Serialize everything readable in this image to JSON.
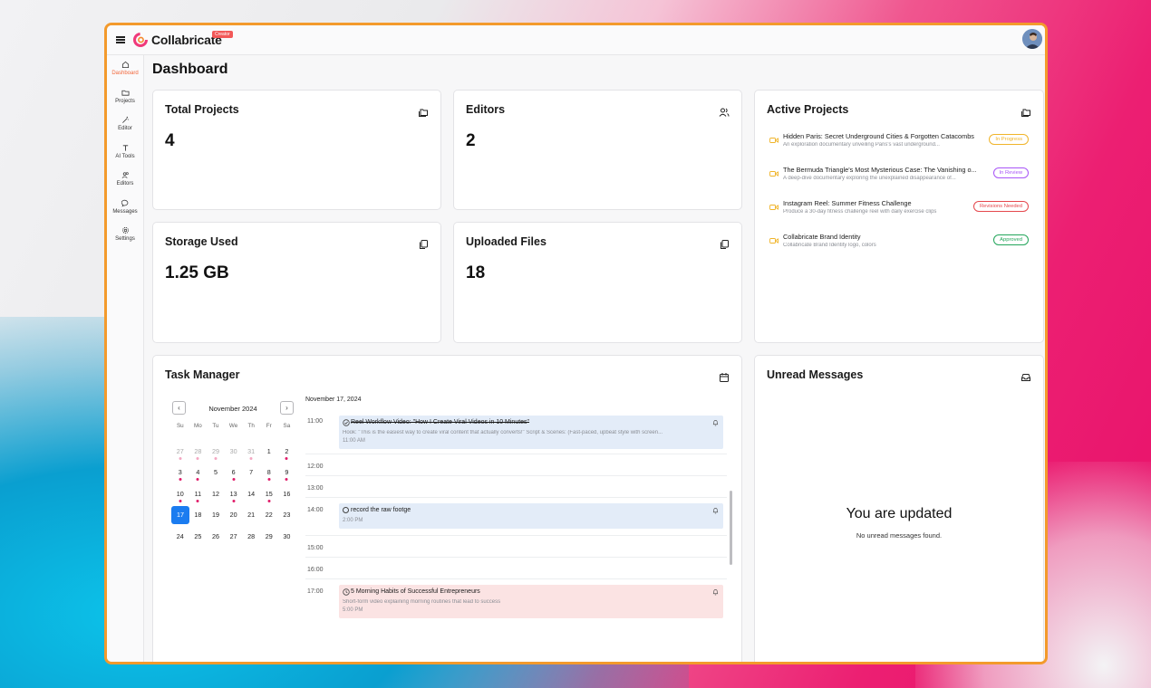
{
  "app": {
    "name": "Collabricate",
    "badge": "Creator"
  },
  "sidebar": {
    "items": [
      {
        "label": "Dashboard",
        "icon": "home-icon",
        "active": true
      },
      {
        "label": "Projects",
        "icon": "folder-icon",
        "active": false
      },
      {
        "label": "Editor",
        "icon": "wand-icon",
        "active": false
      },
      {
        "label": "AI Tools",
        "icon": "text-icon",
        "active": false
      },
      {
        "label": "Editors",
        "icon": "users-icon",
        "active": false
      },
      {
        "label": "Messages",
        "icon": "chat-icon",
        "active": false
      },
      {
        "label": "Settings",
        "icon": "gear-icon",
        "active": false
      }
    ]
  },
  "page": {
    "title": "Dashboard"
  },
  "stats": {
    "total_projects": {
      "label": "Total Projects",
      "value": "4"
    },
    "editors": {
      "label": "Editors",
      "value": "2"
    },
    "storage": {
      "label": "Storage Used",
      "value": "1.25 GB"
    },
    "uploaded": {
      "label": "Uploaded Files",
      "value": "18"
    }
  },
  "active_projects": {
    "title": "Active Projects",
    "items": [
      {
        "title": "Hidden Paris: Secret Underground Cities & Forgotten Catacombs",
        "subtitle": "An exploration documentary unveiling Paris's vast underground...",
        "status": "In Progress",
        "color": "#f0b429"
      },
      {
        "title": "The Bermuda Triangle's Most Mysterious Case: The Vanishing o...",
        "subtitle": "A deep-dive documentary exploring the unexplained disappearance of...",
        "status": "In Review",
        "color": "#a855f7"
      },
      {
        "title": "Instagram Reel: Summer Fitness Challenge",
        "subtitle": "Produce a 30-day fitness challenge reel with daily exercise clips",
        "status": "Revisions Needed",
        "color": "#e5484d"
      },
      {
        "title": "Collabricate Brand Identity",
        "subtitle": "Collabricate Brand Identity logo, colors",
        "status": "Approved",
        "color": "#22a55a"
      }
    ]
  },
  "task_manager": {
    "title": "Task Manager",
    "calendar": {
      "month": "November 2024",
      "weekdays": [
        "Su",
        "Mo",
        "Tu",
        "We",
        "Th",
        "Fr",
        "Sa"
      ],
      "selected": "17"
    },
    "schedule_date": "November 17, 2024",
    "hours": [
      "11:00",
      "12:00",
      "13:00",
      "14:00",
      "15:00",
      "16:00",
      "17:00"
    ],
    "events": [
      {
        "title": "Reel Workflow Video: \"How I Create Viral Videos in 10 Minutes\"",
        "subtitle": "Hook: \"This is the easiest way to create viral content that actually converts!\" Script & Scenes: (Fast-paced, upbeat style with screen...",
        "time": "11:00 AM",
        "done": true
      },
      {
        "title": "record the raw footge",
        "subtitle": "",
        "time": "2:00 PM",
        "done": false
      },
      {
        "title": "5 Morning Habits of Successful Entrepreneurs",
        "subtitle": "Short-form video explaining morning routines that lead to success",
        "time": "5:00 PM",
        "done": false
      }
    ]
  },
  "messages": {
    "title": "Unread Messages",
    "empty_title": "You are updated",
    "empty_sub": "No unread messages found."
  },
  "colors": {
    "accent": "#f2663a",
    "brand_border": "#f39a2c",
    "calendar_today": "#1b7cf0",
    "dot": "#e11d6a"
  }
}
